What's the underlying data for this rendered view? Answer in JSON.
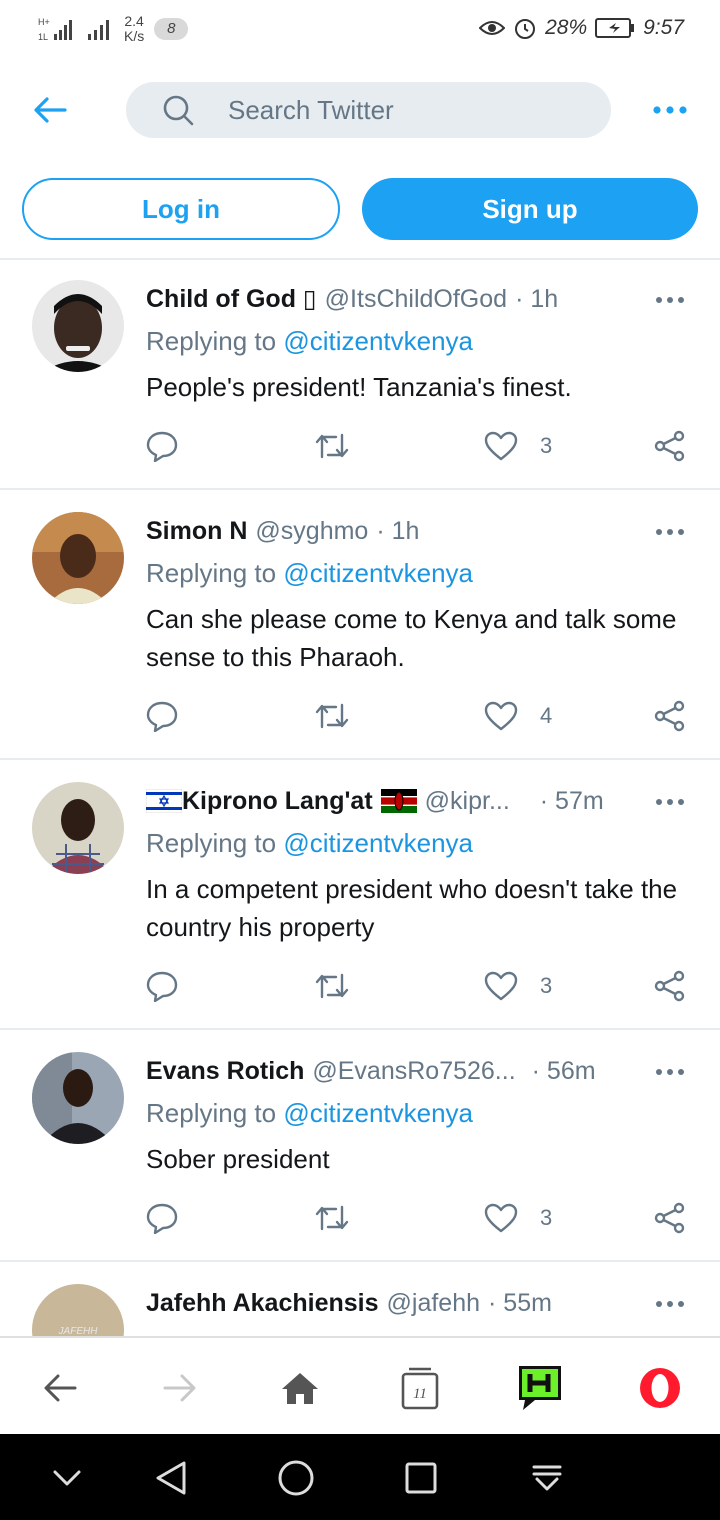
{
  "status_bar": {
    "net_speed_value": "2.4",
    "net_speed_unit": "K/s",
    "notification_count": "8",
    "battery": "28%",
    "time": "9:57"
  },
  "search": {
    "placeholder": "Search Twitter"
  },
  "auth": {
    "login_label": "Log in",
    "signup_label": "Sign up"
  },
  "tweets": [
    {
      "name": "Child of God ▯",
      "handle": "@ItsChildOfGod",
      "time": "· 1h",
      "reply_prefix": "Replying to",
      "reply_to": "@citizentvkenya",
      "text": "People's president! Tanzania's finest.",
      "likes": "3"
    },
    {
      "name": "Simon N",
      "handle": "@syghmo",
      "time": "· 1h",
      "reply_prefix": "Replying to",
      "reply_to": "@citizentvkenya",
      "text": "Can she please come to Kenya and talk some sense to this Pharaoh.",
      "likes": "4"
    },
    {
      "name": "Kiprono Lang'at",
      "handle": "@kipr...",
      "time": "· 57m",
      "reply_prefix": "Replying to",
      "reply_to": "@citizentvkenya",
      "text": "In a competent president who doesn't take the country his property",
      "likes": "3"
    },
    {
      "name": "Evans Rotich",
      "handle": "@EvansRo7526...",
      "time": "· 56m",
      "reply_prefix": "Replying to",
      "reply_to": "@citizentvkenya",
      "text": "Sober president",
      "likes": "3"
    },
    {
      "name": "Jafehh Akachiensis",
      "handle": "@jafehh",
      "time": "· 55m",
      "avatar_text": "JAFEHH"
    }
  ],
  "browser_bar": {
    "tabs_count": "11"
  },
  "colors": {
    "accent": "#1da1f2",
    "mention": "#1b95e0",
    "secondary": "#657786",
    "divider": "#e6ecf0"
  },
  "icons": [
    "back-arrow-icon",
    "search-icon",
    "more-icon",
    "reply-icon",
    "retweet-icon",
    "like-icon",
    "share-icon",
    "home-icon",
    "tabs-icon",
    "news-icon",
    "opera-icon"
  ]
}
